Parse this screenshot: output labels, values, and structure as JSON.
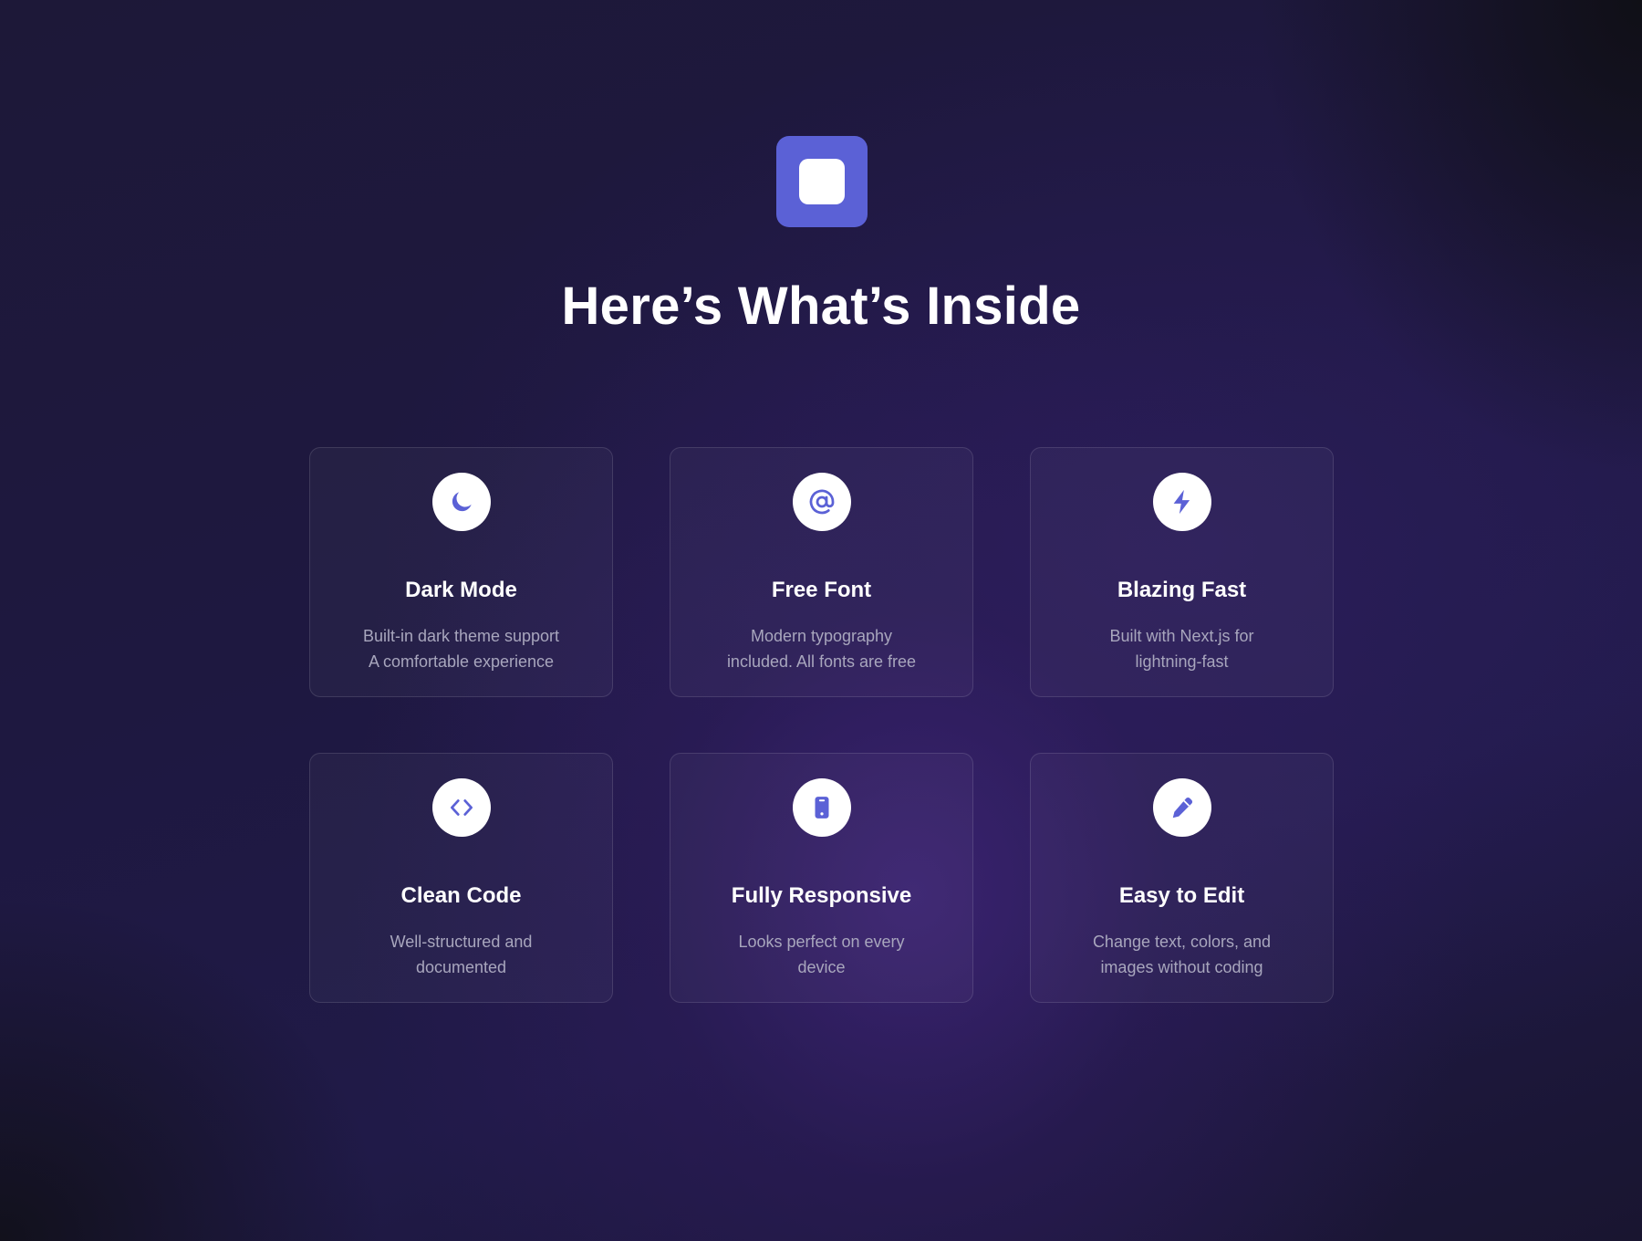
{
  "header": {
    "logo_icon": "square-logo-icon",
    "title": "Here’s What’s Inside"
  },
  "colors": {
    "accent": "#5b61d6",
    "background": "#1e1840",
    "card_text": "#a8a6bd"
  },
  "features": [
    {
      "icon": "moon-icon",
      "title": "Dark Mode",
      "description": "Built-in dark theme support\nA comfortable experience"
    },
    {
      "icon": "at-sign-icon",
      "title": "Free Font",
      "description": "Modern typography\nincluded. All fonts are free"
    },
    {
      "icon": "lightning-icon",
      "title": "Blazing Fast",
      "description": "Built with Next.js for\nlightning-fast"
    },
    {
      "icon": "code-icon",
      "title": "Clean Code",
      "description": "Well-structured and\ndocumented"
    },
    {
      "icon": "mobile-device-icon",
      "title": "Fully Responsive",
      "description": "Looks perfect on every\ndevice"
    },
    {
      "icon": "pencil-icon",
      "title": "Easy to Edit",
      "description": "Change text, colors, and\nimages without coding"
    }
  ]
}
